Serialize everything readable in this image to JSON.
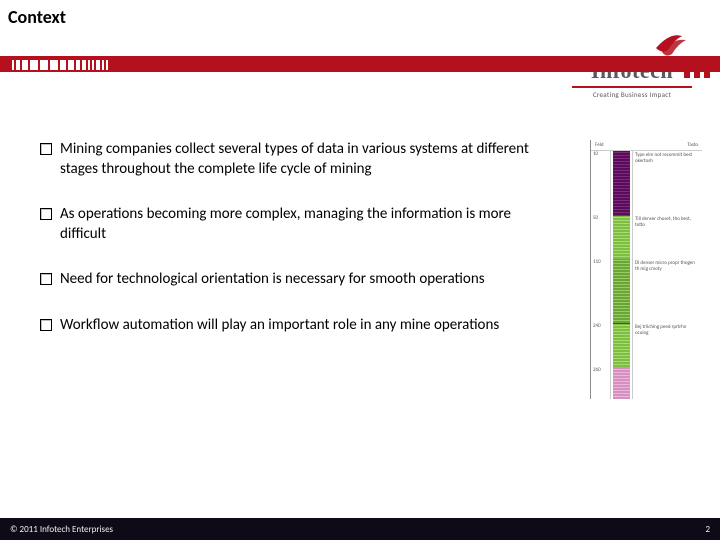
{
  "title": "Context",
  "logo": {
    "name": "Infotech",
    "tagline": "Creating Business Impact"
  },
  "bullets": [
    "Mining companies collect several types of data in various systems at different stages throughout the complete life cycle of mining",
    "As operations becoming more complex, managing the information is more difficult",
    "Need for technological orientation is necessary for smooth operations",
    "Workflow automation will play an important role in any mine operations"
  ],
  "figure": {
    "header_left": "Feld",
    "header_right": "Tasto",
    "rows": [
      {
        "depth": "10",
        "cls": "stripe-purple",
        "desc": "Type elm not recommit best okertosh"
      },
      {
        "depth": "50",
        "cls": "stripe-green",
        "desc": "Till denser choset, tho best, totto"
      },
      {
        "depth": "110",
        "cls": "stripe-green2",
        "desc": "Dl denser micro propr thogen th mig cmoty"
      },
      {
        "depth": "240",
        "cls": "stripe-green",
        "desc": "Bej trliching peed rprtrhn ocuing"
      },
      {
        "depth": "260",
        "cls": "stripe-pink",
        "desc": ""
      }
    ]
  },
  "footer": {
    "left": "© 2011 Infotech Enterprises",
    "page": "2"
  },
  "colors": {
    "accent": "#B5101D",
    "footer": "#0F0A17"
  }
}
